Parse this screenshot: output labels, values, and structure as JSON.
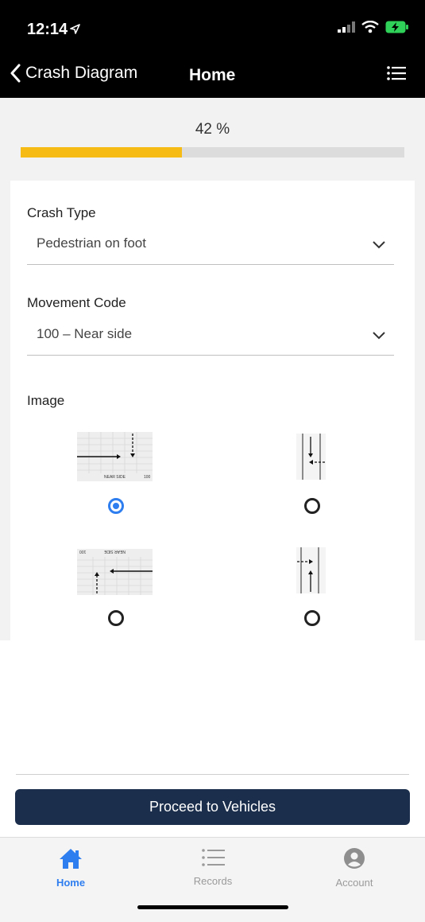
{
  "status_bar": {
    "time": "12:14"
  },
  "nav": {
    "back_label": "Crash  Diagram",
    "title": "Home"
  },
  "progress": {
    "label": "42 %",
    "value": 0.42,
    "fill_color": "#f6bb14"
  },
  "form": {
    "crash_type": {
      "label": "Crash Type",
      "value": "Pedestrian on foot"
    },
    "movement_code": {
      "label": "Movement Code",
      "value": "100 – Near side"
    },
    "image": {
      "label": "Image",
      "options": [
        {
          "caption_left": "NEAR SIDE",
          "caption_right": "100",
          "selected": true
        },
        {
          "selected": false
        },
        {
          "caption_left": "100",
          "caption_right": "NEAR SIDE",
          "selected": false
        },
        {
          "selected": false
        }
      ]
    }
  },
  "actions": {
    "proceed_label": "Proceed to Vehicles"
  },
  "tabbar": {
    "items": [
      {
        "label": "Home",
        "icon": "home-icon",
        "active": true
      },
      {
        "label": "Records",
        "icon": "list-icon",
        "active": false
      },
      {
        "label": "Account",
        "icon": "account-icon",
        "active": false
      }
    ]
  },
  "colors": {
    "accent": "#2f7ef0",
    "button": "#1b2e4b",
    "progress": "#f6bb14"
  }
}
